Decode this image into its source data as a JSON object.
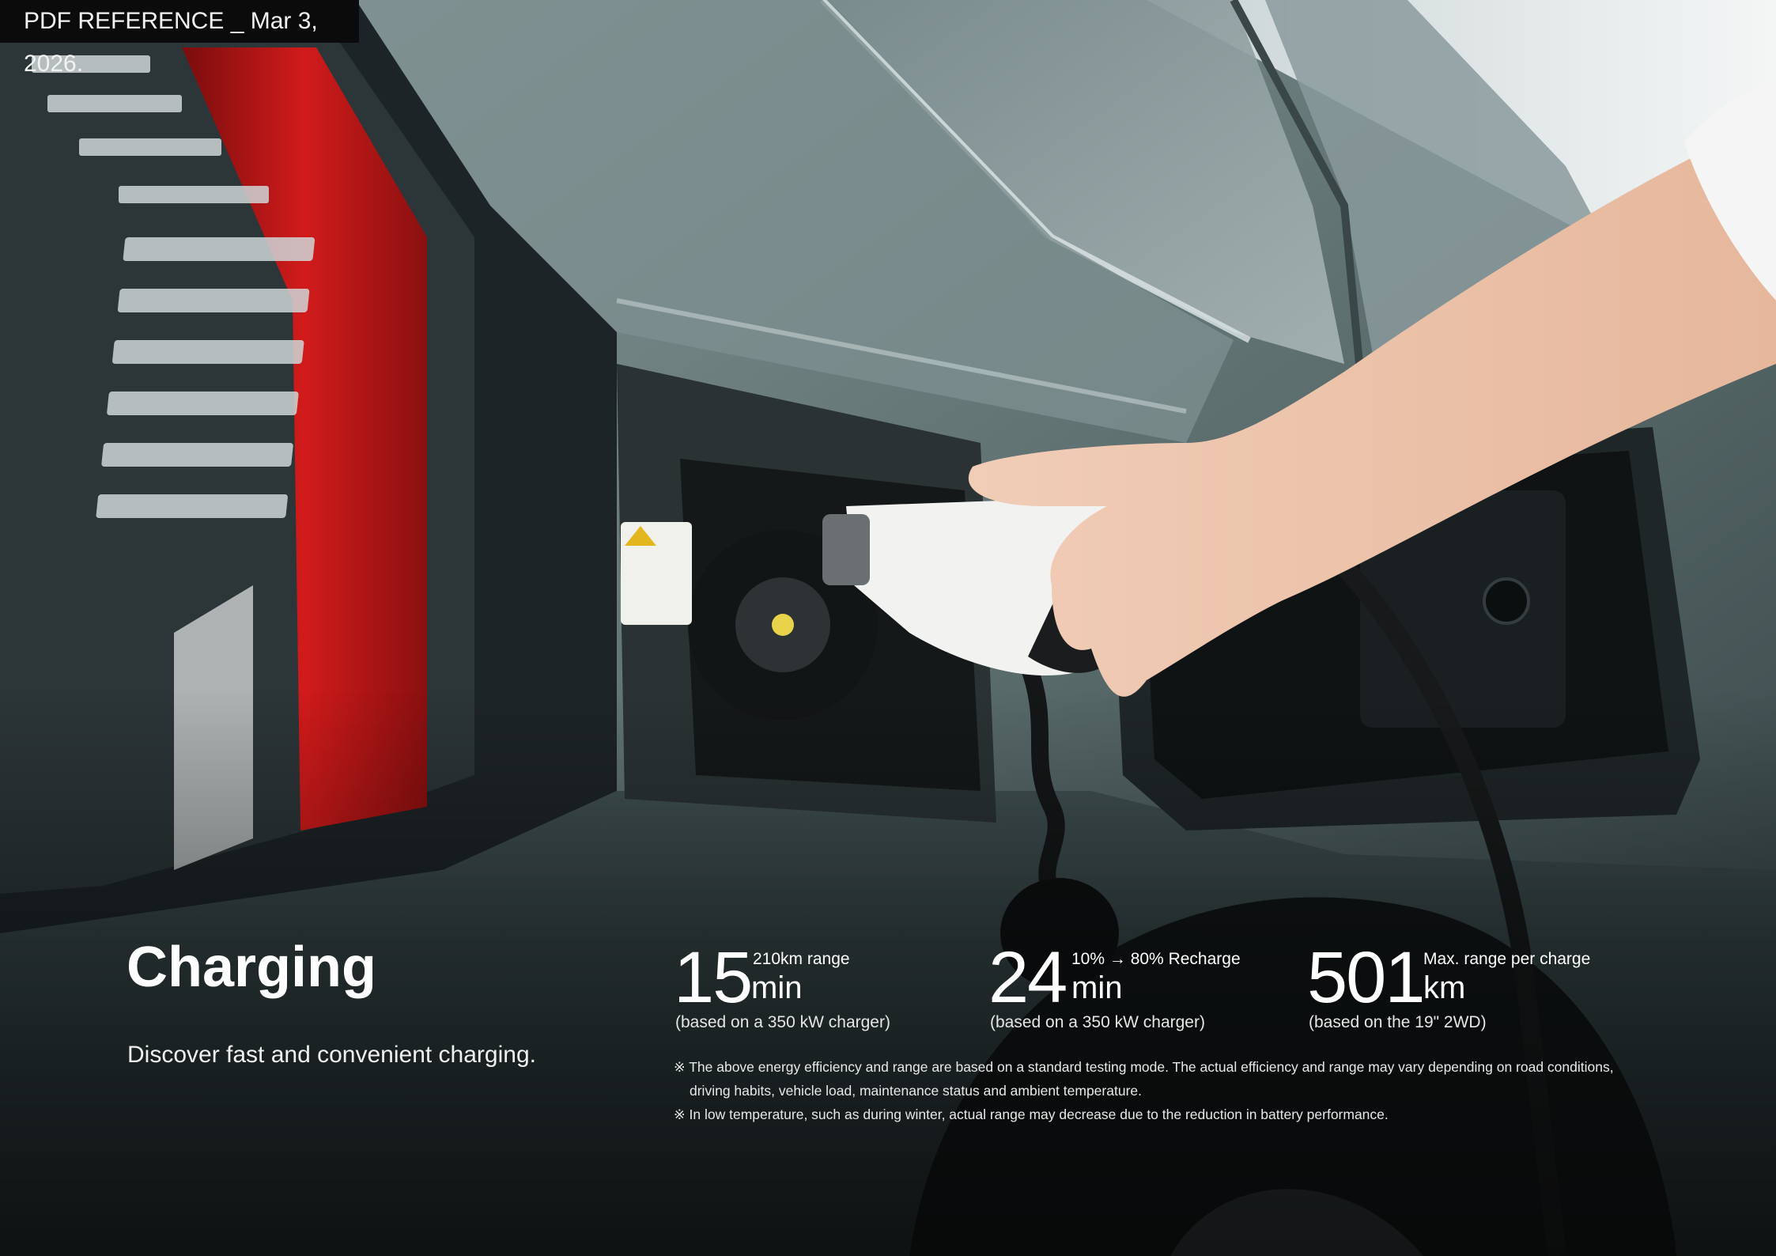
{
  "reference_label": "PDF REFERENCE _ Mar 3, 2026.",
  "heading": "Charging",
  "subheading": "Discover fast and convenient charging.",
  "stats": [
    {
      "number": "15",
      "caption": "210km range",
      "unit": "min",
      "note": "(based on a 350 kW charger)"
    },
    {
      "number": "24",
      "caption": "10% → 80% Recharge",
      "unit": "min",
      "note": "(based on a 350 kW charger)"
    },
    {
      "number": "501",
      "caption": "Max. range per charge",
      "unit": "km",
      "note": "(based on the 19\" 2WD)"
    }
  ],
  "disclaimers": {
    "line1": "※ The above energy efficiency and range are based on a standard testing mode. The actual efficiency and range may vary depending on road conditions,",
    "line1_cont": "driving habits, vehicle load, maintenance status and ambient temperature.",
    "line2": "※ In low temperature, such as during winter, actual range may decrease due to the reduction in battery performance."
  },
  "colors": {
    "car_body": "#5d6f70",
    "tail_light": "#c81a1a",
    "charger_white": "#f2f2f0",
    "text": "#ffffff"
  }
}
